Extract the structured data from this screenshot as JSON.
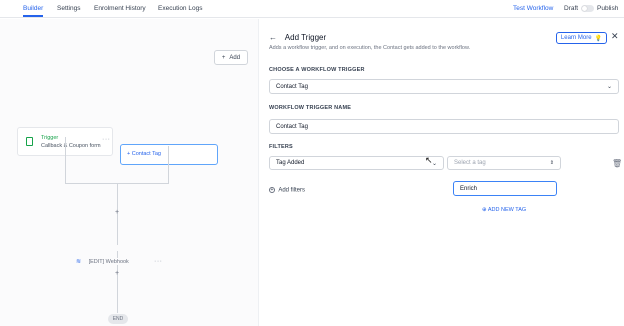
{
  "nav": {
    "tabs": [
      "Builder",
      "Settings",
      "Enrolment History",
      "Execution Logs"
    ],
    "test_workflow": "Test Workflow",
    "draft": "Draft",
    "publish": "Publish"
  },
  "canvas": {
    "add_label": "Add",
    "trigger_node": {
      "title": "Trigger",
      "subtitle": "Callback & Coupon form"
    },
    "contact_tag_node": "+ Contact Tag",
    "webhook_node": "[EDIT] Webhook",
    "end_label": "END"
  },
  "panel": {
    "title": "Add Trigger",
    "subtitle": "Adds a workflow trigger, and on execution, the Contact gets added to the workflow.",
    "learn_more": "Learn More",
    "choose_label": "CHOOSE A WORKFLOW TRIGGER",
    "trigger_select": "Contact Tag",
    "name_label": "WORKFLOW TRIGGER NAME",
    "name_value": "Contact Tag",
    "filters_label": "FILTERS",
    "filter_select": "Tag Added",
    "tag_placeholder": "Select a tag",
    "add_filters": "Add filters",
    "tag_search": "Enrich",
    "add_new_tag": "ADD NEW TAG"
  },
  "colors": {
    "accent": "#2563eb",
    "trigger_green": "#16a34a"
  },
  "icons": [
    "plus-icon",
    "document-icon",
    "more-dots-icon",
    "webhook-icon",
    "back-arrow-icon",
    "lightbulb-icon",
    "close-icon",
    "chevron-down-icon",
    "sort-icon",
    "trash-icon",
    "add-circle-icon"
  ]
}
